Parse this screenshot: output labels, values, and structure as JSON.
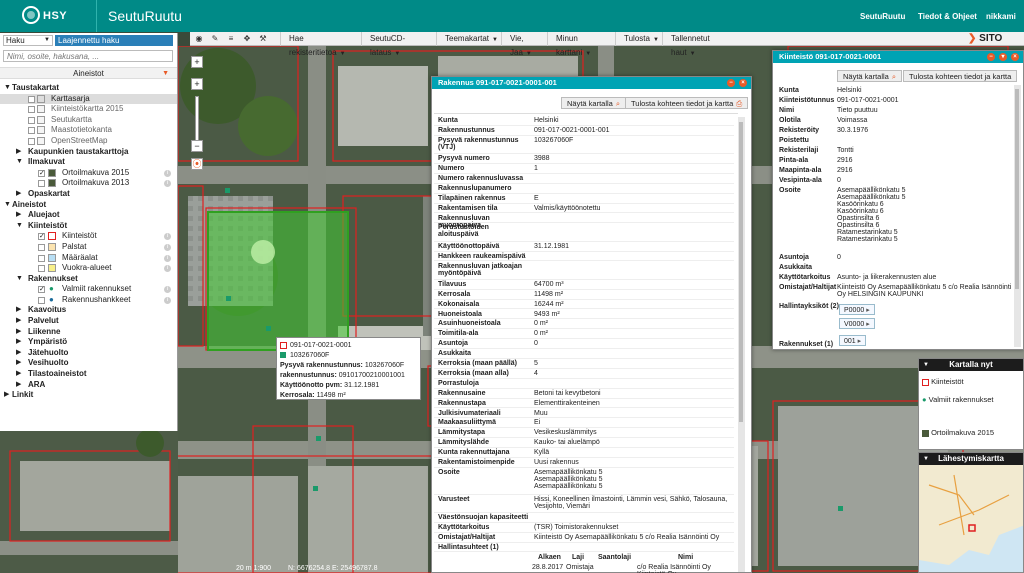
{
  "header": {
    "logo_text": "HSY",
    "app_title": "SeutuRuutu",
    "nav": [
      "SeutuRuutu",
      "Tiedot & Ohjeet",
      "nikkami"
    ]
  },
  "search": {
    "mode": "Haku",
    "advanced_label": "Laajennettu haku",
    "placeholder": "Nimi, osoite, hakusana, ..."
  },
  "layers": {
    "title": "Aineistot",
    "taustakartat": "Taustakartat",
    "kartat": [
      "Karttasarja",
      "Kiinteistökartta 2015",
      "Seutukartta",
      "Maastotietokanta",
      "OpenStreetMap"
    ],
    "kaupunkien": "Kaupunkien taustakarttoja",
    "ilmakuvat": "Ilmakuvat",
    "ilmakuva_items": [
      "Ortoilmakuva 2015",
      "Ortoilmakuva 2013"
    ],
    "opaskartat": "Opaskartat",
    "aineistot": "Aineistot",
    "aluejaot": "Aluejaot",
    "kiinteistot": "Kiinteistöt",
    "kiinteisto_items": [
      "Kiinteistöt",
      "Palstat",
      "Määräalat",
      "Vuokra-alueet"
    ],
    "rakennukset": "Rakennukset",
    "rakennus_items": [
      "Valmiit rakennukset",
      "Rakennushankkeet"
    ],
    "groups": [
      "Kaavoitus",
      "Palvelut",
      "Liikenne",
      "Ympäristö",
      "Jätehuolto",
      "Vesihuolto",
      "Tilastoaineistot",
      "ARA"
    ],
    "linkit": "Linkit"
  },
  "toolbar": {
    "menus": [
      "Hae rekisteritietoa",
      "SeutuCD-lataus",
      "Teemakartat",
      "Vie, Jaa",
      "Minun karttani",
      "Tulosta",
      "Tallennetut haut"
    ],
    "brand": "SITO"
  },
  "map": {
    "zoom_in": "+",
    "zoom_out": "−",
    "scale": "20 m 1:900",
    "coords": "N: 6676254.8 E: 25496787.8"
  },
  "popup": {
    "kiinteisto": "091-017-0021-0001",
    "rakennus": "103267060F",
    "lines": [
      {
        "k": "Pysyvä rakennustunnus:",
        "v": "103267060F"
      },
      {
        "k": "rakennustunnus:",
        "v": "09101700210001001"
      },
      {
        "k": "Käyttöönotto pvm:",
        "v": "31.12.1981"
      },
      {
        "k": "Kerrosala:",
        "v": "11498 m²"
      }
    ]
  },
  "rakennus_window": {
    "title": "Rakennus 091-017-0021-0001-001",
    "show_on_map": "Näytä kartalla",
    "print": "Tulosta kohteen tiedot ja kartta",
    "rows": [
      {
        "k": "Kunta",
        "v": "Helsinki"
      },
      {
        "k": "Rakennustunnus",
        "v": "091-017-0021-0001-001"
      },
      {
        "k": "Pysyvä rakennustunnus (VTJ)",
        "v": "103267060F"
      },
      {
        "k": "Pysyvä numero",
        "v": "3988"
      },
      {
        "k": "Numero",
        "v": "1"
      },
      {
        "k": "Numero rakennusluvassa",
        "v": ""
      },
      {
        "k": "Rakennuslupanumero",
        "v": ""
      },
      {
        "k": "Tilapäinen rakennus",
        "v": "E"
      },
      {
        "k": "Rakentamisen tila",
        "v": "Valmis/käyttöönotettu"
      },
      {
        "k": "Rakennusluvan myöntöpäivä",
        "v": ""
      },
      {
        "k": "Perustustöiden aloituspäivä",
        "v": ""
      },
      {
        "k": "Käyttöönottopäivä",
        "v": "31.12.1981"
      },
      {
        "k": "Hankkeen raukeamispäivä",
        "v": ""
      },
      {
        "k": "Rakennusluvan jatkoajan myöntöpäivä",
        "v": ""
      },
      {
        "k": "Tilavuus",
        "v": "64700 m³"
      },
      {
        "k": "Kerrosala",
        "v": "11498 m²"
      },
      {
        "k": "Kokonaisala",
        "v": "16244 m²"
      },
      {
        "k": "Huoneistoala",
        "v": "9493 m²"
      },
      {
        "k": "Asuinhuoneistoala",
        "v": "0 m²"
      },
      {
        "k": "Toimitila-ala",
        "v": "0 m²"
      },
      {
        "k": "Asuntoja",
        "v": "0"
      },
      {
        "k": "Asukkaita",
        "v": ""
      },
      {
        "k": "Kerroksia (maan päällä)",
        "v": "5"
      },
      {
        "k": "Kerroksia (maan alla)",
        "v": "4"
      },
      {
        "k": "Porrastuloja",
        "v": ""
      },
      {
        "k": "Rakennusaine",
        "v": "Betoni tai kevytbetoni"
      },
      {
        "k": "Rakennustapa",
        "v": "Elementtirakenteinen"
      },
      {
        "k": "Julkisivumateriaali",
        "v": "Muu"
      },
      {
        "k": "Maakaasuliittymä",
        "v": "Ei"
      },
      {
        "k": "Lämmitystapa",
        "v": "Vesikeskuslämmitys"
      },
      {
        "k": "Lämmityslähde",
        "v": "Kauko- tai aluelämpö"
      },
      {
        "k": "Kunta rakennuttajana",
        "v": "Kyllä"
      },
      {
        "k": "Rakentamistoimenpide",
        "v": "Uusi rakennus"
      },
      {
        "k": "Osoite",
        "v": "Asemapäällikönkatu 5\nAsemapäällikönkatu 5\nAsemapäällikönkatu 5"
      },
      {
        "k": "Varusteet",
        "v": "Hissi, Koneellinen ilmastointi, Lämmin vesi, Sähkö, Talosauna, Vesijohto, Viemäri"
      },
      {
        "k": "Väestönsuojan kapasiteetti",
        "v": ""
      },
      {
        "k": "Käyttötarkoitus",
        "v": "(TSR) Toimistorakennukset"
      },
      {
        "k": "Omistajat/Haltijat",
        "v": "Kiinteistö Oy Asemapäällikönkatu 5 c/o Realia Isännöinti Oy"
      },
      {
        "k": "Hallintasuhteet (1)",
        "v": ""
      }
    ],
    "hallinta_headers": [
      "Alkaen",
      "Laji",
      "Saantolaji",
      "Nimi"
    ],
    "hallinta_row": [
      "28.8.2017",
      "Omistaja",
      "",
      "c/o Realia Isännöinti Oy Kiinteistö Oy Asemapäällikönkatu 5"
    ]
  },
  "kiinteisto_window": {
    "title": "Kiinteistö 091-017-0021-0001",
    "show_on_map": "Näytä kartalla",
    "print": "Tulosta kohteen tiedot ja kartta",
    "rows": [
      {
        "k": "Kunta",
        "v": "Helsinki"
      },
      {
        "k": "Kiinteistötunnus",
        "v": "091-017-0021-0001"
      },
      {
        "k": "Nimi",
        "v": "Tieto puuttuu"
      },
      {
        "k": "Olotila",
        "v": "Voimassa"
      },
      {
        "k": "Rekisteröity",
        "v": "30.3.1976"
      },
      {
        "k": "Poistettu",
        "v": ""
      },
      {
        "k": "Rekisterilaji",
        "v": "Tontti"
      },
      {
        "k": "Pinta-ala",
        "v": "2916"
      },
      {
        "k": "Maapinta-ala",
        "v": "2916"
      },
      {
        "k": "Vesipinta-ala",
        "v": "0"
      },
      {
        "k": "Osoite",
        "v": "Asemapäällikönkatu 5\nAsemapäällikönkatu 5\nKasöörinkatu 6\nKasöörinkatu 6\nOpastinsilta 6\nOpastinsilta 6\nRatamestarinkatu 5\nRatamestarinkatu 5"
      },
      {
        "k": "Asuntoja",
        "v": "0"
      },
      {
        "k": "Asukkaita",
        "v": ""
      },
      {
        "k": "Käyttötarkoitus",
        "v": "Asunto- ja liikerakennusten alue"
      },
      {
        "k": "Omistajat/Haltijat",
        "v": "Kiinteistö Oy Asemapäällikönkatu 5 c/o Realia Isännöinti Oy HELSINGIN KAUPUNKI"
      },
      {
        "k": "Hallintayksiköt (2)",
        "v": ""
      },
      {
        "k": "Rakennukset (1)",
        "v": ""
      }
    ],
    "hallinta_pills": [
      "P0000",
      "V0000"
    ],
    "rakennus_pill": "001"
  },
  "kartalla_nyt": {
    "title": "Kartalla nyt",
    "items": [
      "Kiinteistöt",
      "Valmiit rakennukset",
      "Ortoilmakuva 2015"
    ]
  },
  "lahestymiskartta": {
    "title": "Lähestymiskartta"
  },
  "colors": {
    "header": "#008a87",
    "window_title": "#00a3b4",
    "accent": "#e85b28",
    "selection": "#44cc33"
  }
}
